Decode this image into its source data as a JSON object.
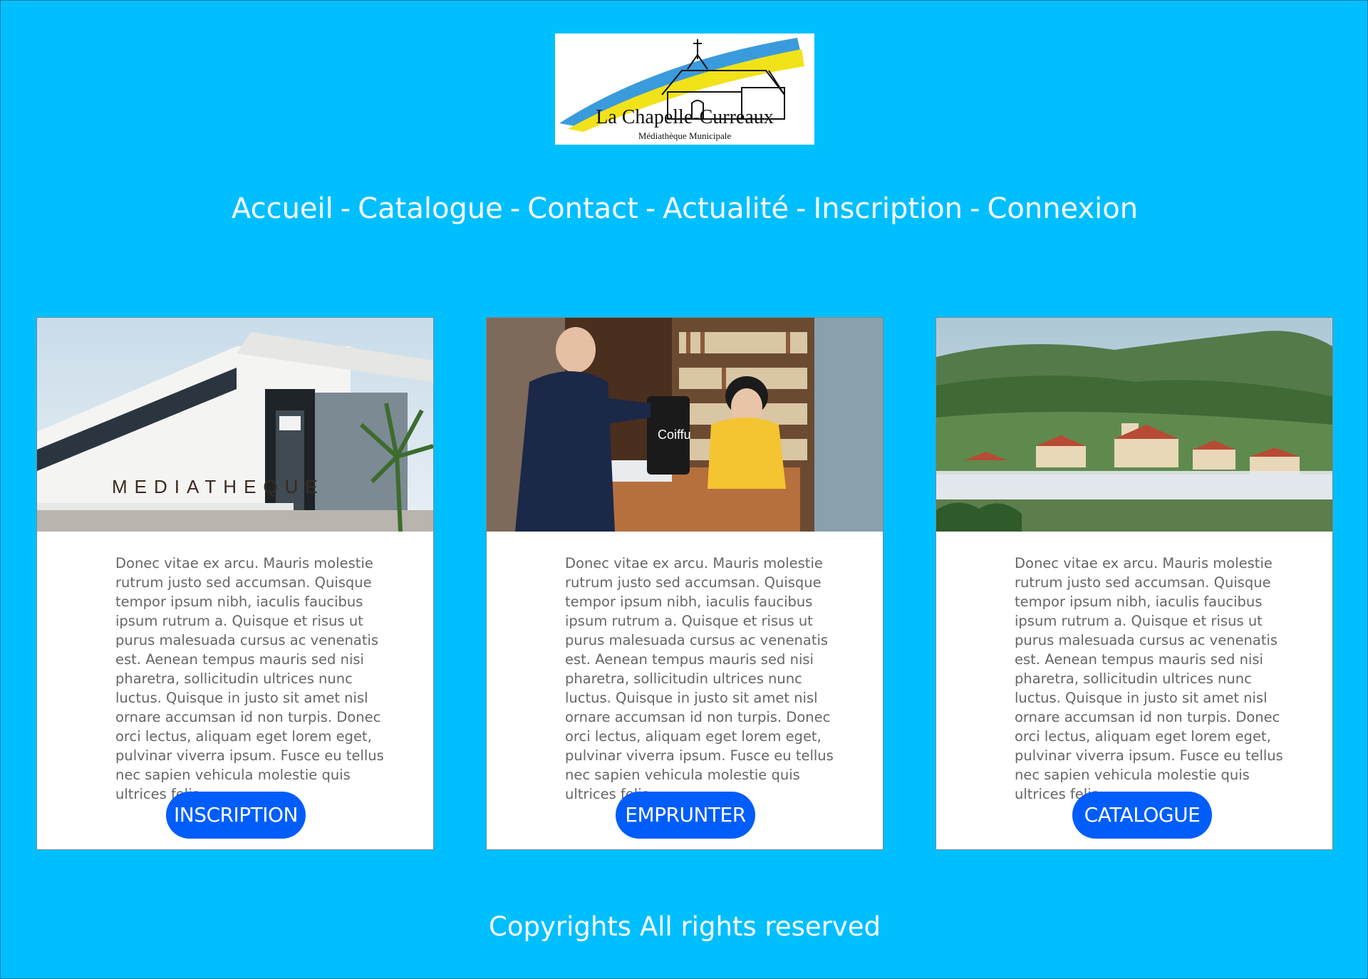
{
  "site": {
    "logo_title": "La Chapelle-Curreaux",
    "logo_subtitle": "Médiathèque Municipale",
    "colors": {
      "background": "#00bfff",
      "button": "#005dfa",
      "card": "#ffffff",
      "text": "#666666"
    }
  },
  "nav": {
    "separator": "-",
    "items": [
      {
        "label": "Accueil"
      },
      {
        "label": "Catalogue"
      },
      {
        "label": "Contact"
      },
      {
        "label": "Actualité"
      },
      {
        "label": "Inscription"
      },
      {
        "label": "Connexion"
      }
    ]
  },
  "cards": [
    {
      "image": "mediatheque-building-photo",
      "image_text": "MEDIATHEQUE",
      "text": "Donec vitae ex arcu. Mauris molestie rutrum justo sed accumsan. Quisque tempor ipsum nibh, iaculis faucibus ipsum rutrum a. Quisque et risus ut purus malesuada cursus ac venenatis est. Aenean tempus mauris sed nisi pharetra, sollicitudin ultrices nunc luctus. Quisque in justo sit amet nisl ornare accumsan id non turpis. Donec orci lectus, aliquam eget lorem eget, pulvinar viverra ipsum. Fusce eu tellus nec sapien vehicula molestie quis ultrices felis.",
      "button": "INSCRIPTION"
    },
    {
      "image": "bookshop-counter-photo",
      "text": "Donec vitae ex arcu. Mauris molestie rutrum justo sed accumsan. Quisque tempor ipsum nibh, iaculis faucibus ipsum rutrum a. Quisque et risus ut purus malesuada cursus ac venenatis est. Aenean tempus mauris sed nisi pharetra, sollicitudin ultrices nunc luctus. Quisque in justo sit amet nisl ornare accumsan id non turpis. Donec orci lectus, aliquam eget lorem eget, pulvinar viverra ipsum. Fusce eu tellus nec sapien vehicula molestie quis ultrices felis.",
      "button": "EMPRUNTER"
    },
    {
      "image": "village-landscape-photo",
      "text": "Donec vitae ex arcu. Mauris molestie rutrum justo sed accumsan. Quisque tempor ipsum nibh, iaculis faucibus ipsum rutrum a. Quisque et risus ut purus malesuada cursus ac venenatis est. Aenean tempus mauris sed nisi pharetra, sollicitudin ultrices nunc luctus. Quisque in justo sit amet nisl ornare accumsan id non turpis. Donec orci lectus, aliquam eget lorem eget, pulvinar viverra ipsum. Fusce eu tellus nec sapien vehicula molestie quis ultrices felis.",
      "button": "CATALOGUE"
    }
  ],
  "footer": {
    "text": "Copyrights All rights reserved"
  }
}
